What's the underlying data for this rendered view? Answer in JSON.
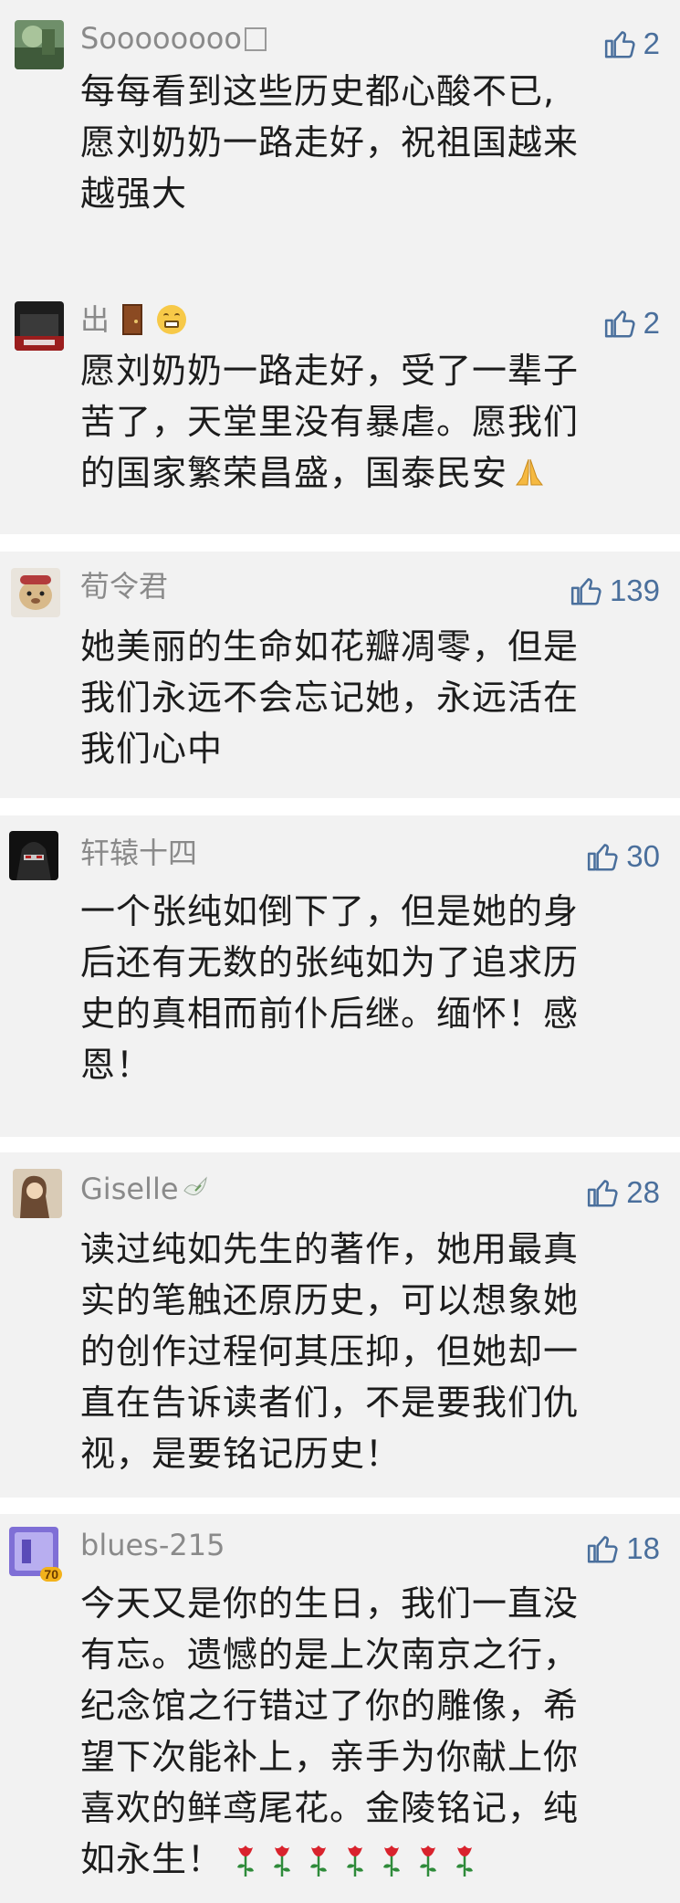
{
  "comments": [
    {
      "name": "Soooooooo",
      "likes": "2",
      "lines": [
        "每每看到这些历史都心酸不已,",
        "愿刘奶奶一路走好，祝祖国越来",
        "越强大"
      ]
    },
    {
      "name": "出",
      "likes": "2",
      "lines": [
        "愿刘奶奶一路走好，受了一辈子",
        "苦了，天堂里没有暴虐。愿我们",
        "的国家繁荣昌盛，国泰民安"
      ]
    },
    {
      "name": "荀令君",
      "likes": "139",
      "lines": [
        "她美丽的生命如花瓣凋零，但是",
        "我们永远不会忘记她，永远活在",
        "我们心中"
      ]
    },
    {
      "name": "轩辕十四",
      "likes": "30",
      "lines": [
        "一个张纯如倒下了，但是她的身",
        "后还有无数的张纯如为了追求历",
        "史的真相而前仆后继。缅怀！感",
        "恩！"
      ]
    },
    {
      "name": "Giselle",
      "likes": "28",
      "lines": [
        "读过纯如先生的著作，她用最真",
        "实的笔触还原历史，可以想象她",
        "的创作过程何其压抑，但她却一",
        "直在告诉读者们，不是要我们仇",
        "视，是要铭记历史！"
      ]
    },
    {
      "name": "blues-215",
      "likes": "18",
      "lines": [
        "今天又是你的生日，我们一直没",
        "有忘。遗憾的是上次南京之行，",
        "纪念馆之行错过了你的雕像，希",
        "望下次能补上，亲手为你献上你",
        "喜欢的鲜鸢尾花。金陵铭记，纯",
        "如永生！"
      ]
    }
  ],
  "avatar_badge": "70",
  "emoji": {
    "door": "door-emoji",
    "grin": "grin-emoji",
    "pray": "pray-emoji",
    "dove": "dove-emoji",
    "rose": "rose-emoji"
  },
  "colors": {
    "card_bg": "#f2f2f2",
    "like_blue": "#4a6f9c",
    "name_gray": "#8a8a8a"
  }
}
